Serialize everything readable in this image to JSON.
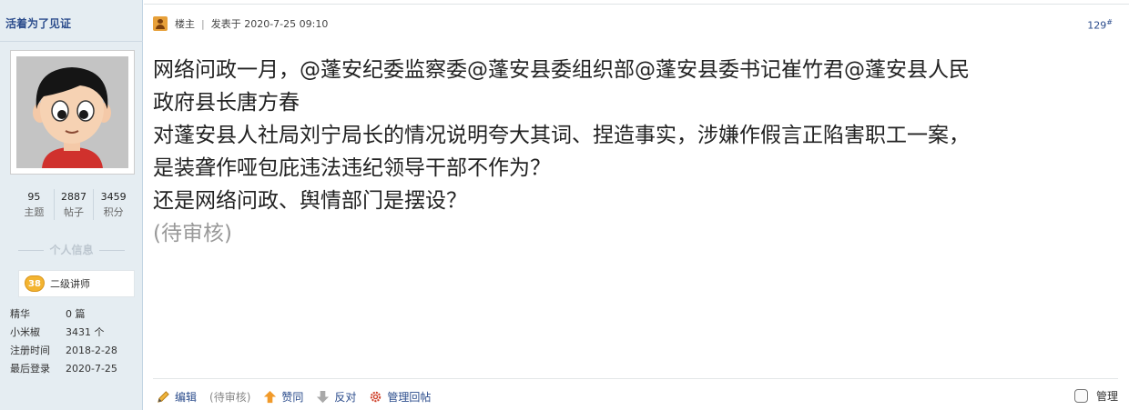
{
  "user": {
    "name": "活着为了见证",
    "stats": [
      {
        "value": "95",
        "label": "主题"
      },
      {
        "value": "2887",
        "label": "帖子"
      },
      {
        "value": "3459",
        "label": "积分"
      }
    ],
    "section_title": "个人信息",
    "rank": {
      "level": "38",
      "title": "二级讲师"
    },
    "info": [
      {
        "key": "精华",
        "value": "0 篇"
      },
      {
        "key": "小米椒",
        "value": "3431 个"
      },
      {
        "key": "注册时间",
        "value": "2018-2-28"
      },
      {
        "key": "最后登录",
        "value": "2020-7-25"
      }
    ]
  },
  "post": {
    "author_label": "楼主",
    "posted_at": "发表于 2020-7-25 09:10",
    "floor_number": "129",
    "floor_suffix": "#",
    "lines": [
      "网络问政一月，@蓬安纪委监察委@蓬安县委组织部@蓬安县委书记崔竹君@蓬安县人民",
      "政府县长唐方春",
      "对蓬安县人社局刘宁局长的情况说明夸大其词、捏造事实，涉嫌作假言正陷害职工一案，",
      "是装聋作哑包庇违法违纪领导干部不作为？",
      "还是网络问政、舆情部门是摆设？"
    ],
    "pending_label": "(待审核)"
  },
  "actions": {
    "edit": "编辑",
    "edit_status": "(待审核)",
    "upvote": "赞同",
    "downvote": "反对",
    "manage_reply": "管理回帖",
    "manage": "管理"
  },
  "icons": {
    "op": "op-user-icon",
    "edit": "pencil-icon",
    "upvote": "arrow-up-icon",
    "downvote": "arrow-down-icon",
    "manage_reply": "gear-icon"
  }
}
